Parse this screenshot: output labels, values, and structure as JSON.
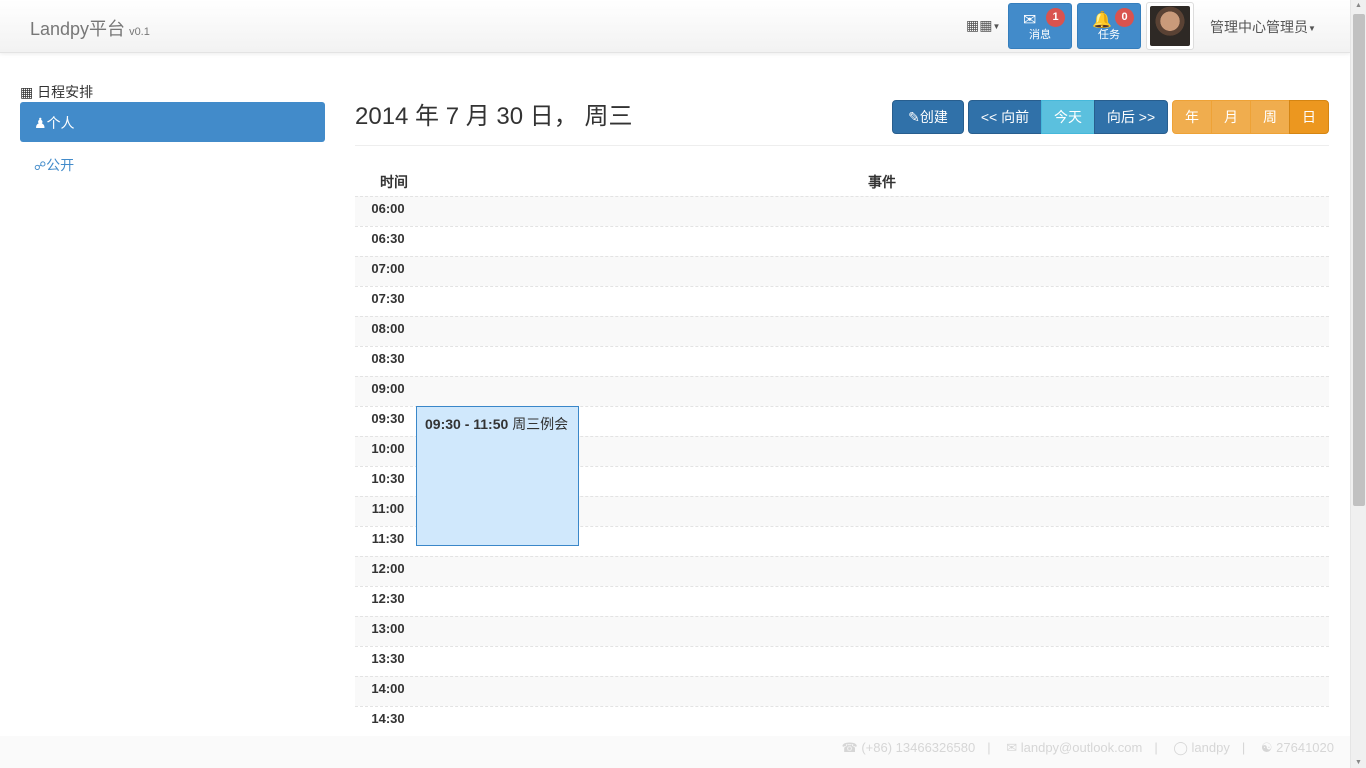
{
  "navbar": {
    "brand": "Landpy平台",
    "version": "v0.1",
    "apps_icon": "grid-icon",
    "messages": {
      "icon": "envelope-icon",
      "label": "消息",
      "count": "1"
    },
    "tasks": {
      "icon": "bell-icon",
      "label": "任务",
      "count": "0"
    },
    "user_name": "管理中心管理员"
  },
  "sidebar": {
    "header": "日程安排",
    "header_icon": "calendar-icon",
    "items": [
      {
        "label": "个人",
        "icon": "user-icon",
        "active": true
      },
      {
        "label": "公开",
        "icon": "share-icon",
        "active": false
      }
    ]
  },
  "calendar": {
    "date_title": "2014 年 7 月 30 日， 周三",
    "create_label": "创建",
    "prev_label": "<< 向前",
    "today_label": "今天",
    "next_label": "向后 >>",
    "views": [
      "年",
      "月",
      "周",
      "日"
    ],
    "active_view": "日",
    "col_time": "时间",
    "col_event": "事件",
    "times": [
      "06:00",
      "06:30",
      "07:00",
      "07:30",
      "08:00",
      "08:30",
      "09:00",
      "09:30",
      "10:00",
      "10:30",
      "11:00",
      "11:30",
      "12:00",
      "12:30",
      "13:00",
      "13:30",
      "14:00",
      "14:30"
    ],
    "event": {
      "time": "09:30 - 11:50",
      "title": "周三例会"
    }
  },
  "footer": {
    "phone": "(+86) 13466326580",
    "email": "landpy@outlook.com",
    "skype": "landpy",
    "qq": "27641020"
  },
  "colors": {
    "primary": "#428bca",
    "info": "#5bc0de",
    "warning": "#f0ad4e",
    "danger": "#d9534f",
    "event_bg": "#d0e8fc"
  }
}
